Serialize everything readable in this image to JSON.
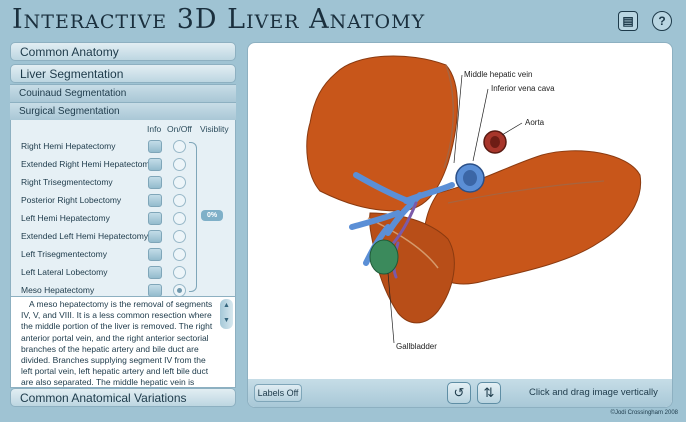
{
  "app": {
    "title": "Interactive 3D Liver Anatomy",
    "help_icon": "help-icon",
    "book_icon": "book-icon"
  },
  "sidebar": {
    "sections": {
      "common_anatomy": "Common Anatomy",
      "liver_segmentation": "Liver Segmentation",
      "couinaud": "Couinaud Segmentation",
      "surgical": "Surgical Segmentation",
      "variations": "Common Anatomical Variations"
    },
    "columns": {
      "info": "Info",
      "onoff": "On/Off",
      "visibility": "Visiblity"
    },
    "procedures": [
      {
        "label": "Right Hemi Hepatectomy",
        "selected": false
      },
      {
        "label": "Extended Right Hemi Hepatectomy",
        "selected": false
      },
      {
        "label": "Right Trisegmentectomy",
        "selected": false
      },
      {
        "label": "Posterior Right Lobectomy",
        "selected": false
      },
      {
        "label": "Left Hemi Hepatectomy",
        "selected": false
      },
      {
        "label": "Extended Left Hemi Hepatectomy",
        "selected": false
      },
      {
        "label": "Left Trisegmentectomy",
        "selected": false
      },
      {
        "label": "Left Lateral Lobectomy",
        "selected": false
      },
      {
        "label": "Meso Hepatectomy",
        "selected": true
      }
    ],
    "visibility_value": "0%",
    "description": "A meso hepatectomy is the removal of segments IV, V, and VIII. It is a less common resection where the middle portion of the liver is removed. The right anterior portal vein, and the right anterior sectorial branches of the hepatic artery and bile duct are divided. Branches supplying segment IV from the left portal vein, left hepatic artery and left bile duct are also separated. The middle hepatic vein is divided."
  },
  "viewer": {
    "labels": {
      "middle_hepatic_vein": "Middle hepatic vein",
      "inferior_vena_cava": "Inferior vena cava",
      "aorta": "Aorta",
      "gallbladder": "Gallbladder"
    },
    "labels_button": "Labels Off",
    "rotate_icon": "rotate-horizontal-icon",
    "rotate_vertical_icon": "rotate-vertical-icon",
    "hint": "Click and drag image vertically"
  },
  "credit": "©Jodi Crossingham 2008",
  "colors": {
    "liver": "#c8561a",
    "vein_blue": "#5b8fd6",
    "aorta": "#a8362b",
    "gallbladder": "#3b8a5c",
    "bile_purple": "#7b5aa8",
    "background": "#9fc3d3"
  }
}
